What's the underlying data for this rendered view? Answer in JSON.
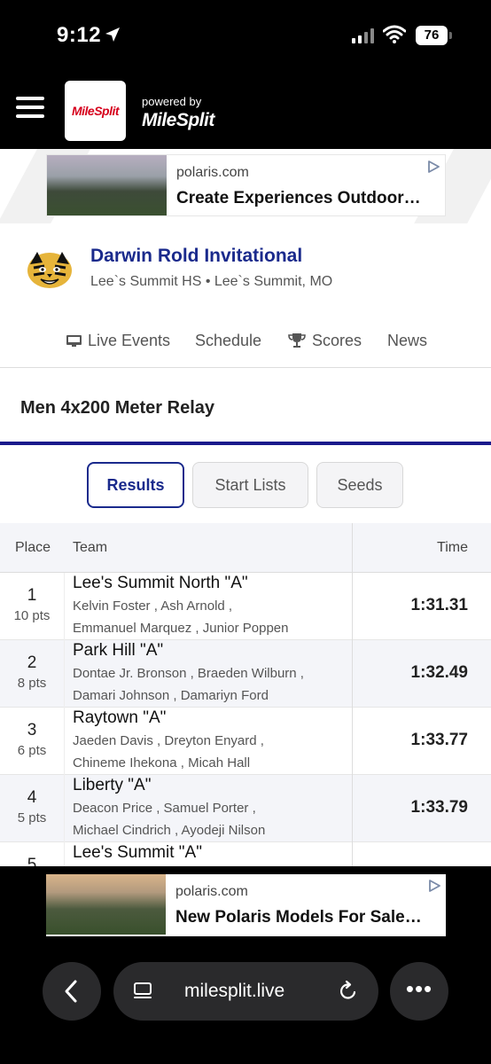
{
  "status_bar": {
    "time": "9:12",
    "battery": "76"
  },
  "nav": {
    "logo_text": "MileSplit",
    "powered_by": "powered by",
    "powered_brand": "MileSplit"
  },
  "ads": [
    {
      "domain": "polaris.com",
      "headline": "Create Experiences Outdoor…"
    },
    {
      "domain": "polaris.com",
      "headline": "New Polaris Models For Sale…"
    }
  ],
  "event": {
    "title": "Darwin Rold Invitational",
    "subtitle": "Lee`s Summit HS • Lee`s Summit, MO"
  },
  "tabs": [
    {
      "label": "Live Events",
      "icon": "live-events-icon"
    },
    {
      "label": "Schedule"
    },
    {
      "label": "Scores",
      "icon": "trophy-icon"
    },
    {
      "label": "News"
    }
  ],
  "section_title": "Men 4x200 Meter Relay",
  "result_tabs": [
    {
      "label": "Results",
      "active": true
    },
    {
      "label": "Start Lists",
      "active": false
    },
    {
      "label": "Seeds",
      "active": false
    }
  ],
  "table": {
    "headers": {
      "place": "Place",
      "team": "Team",
      "time": "Time"
    },
    "rows": [
      {
        "place": "1",
        "pts": "10 pts",
        "team": "Lee's Summit North \"A\"",
        "athletes_1": "Kelvin Foster ,  Ash Arnold ,",
        "athletes_2": "Emmanuel Marquez ,  Junior Poppen",
        "time": "1:31.31"
      },
      {
        "place": "2",
        "pts": "8 pts",
        "team": "Park Hill \"A\"",
        "athletes_1": "Dontae Jr. Bronson ,  Braeden Wilburn ,",
        "athletes_2": "Damari Johnson ,  Damariyn Ford",
        "time": "1:32.49"
      },
      {
        "place": "3",
        "pts": "6 pts",
        "team": "Raytown \"A\"",
        "athletes_1": "Jaeden Davis ,  Dreyton Enyard ,",
        "athletes_2": "Chineme Ihekona ,  Micah Hall",
        "time": "1:33.77"
      },
      {
        "place": "4",
        "pts": "5 pts",
        "team": "Liberty \"A\"",
        "athletes_1": "Deacon Price ,  Samuel Porter ,",
        "athletes_2": "Michael Cindrich ,  Ayodeji Nilson",
        "time": "1:33.79"
      },
      {
        "place": "5",
        "pts": "",
        "team": "Lee's Summit \"A\"",
        "athletes_1": "",
        "athletes_2": "",
        "time": ""
      }
    ]
  },
  "browser": {
    "url": "milesplit.live"
  },
  "colors": {
    "accent": "#1a2a8c",
    "brand_red": "#d6001c"
  }
}
